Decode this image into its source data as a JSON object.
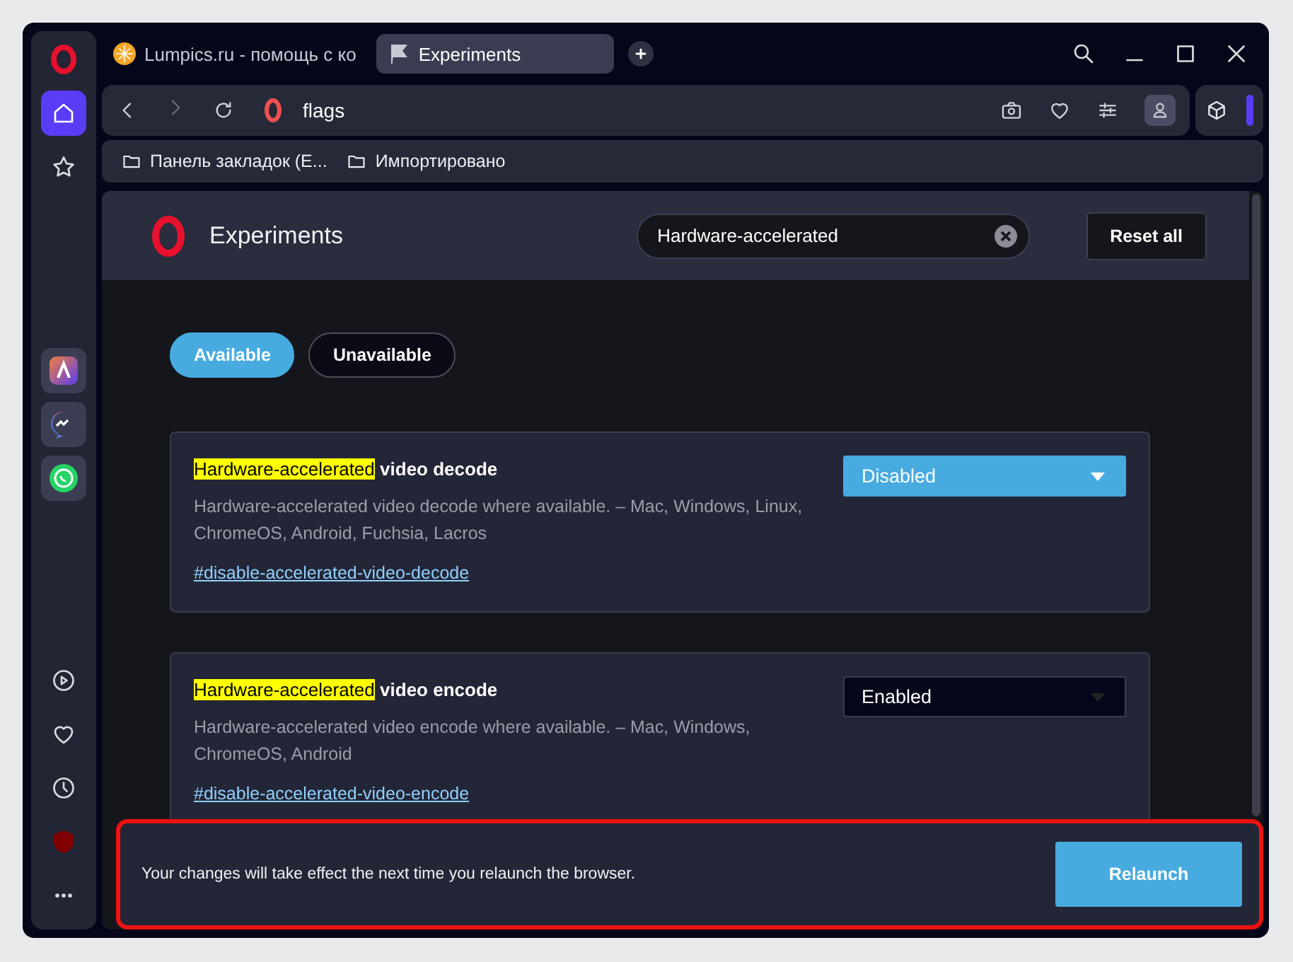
{
  "browser_tabs": [
    {
      "title": "Lumpics.ru - помощь с ко",
      "selected": false
    },
    {
      "title": "Experiments",
      "selected": true
    }
  ],
  "address_bar": {
    "value": "flags"
  },
  "bookmarks": [
    {
      "label": "Панель закладок (Е..."
    },
    {
      "label": "Импортировано"
    }
  ],
  "page": {
    "title": "Experiments",
    "search": {
      "value": "Hardware-accelerated"
    },
    "reset_button": "Reset all",
    "filter_tabs": [
      {
        "label": "Available",
        "selected": true
      },
      {
        "label": "Unavailable",
        "selected": false
      }
    ],
    "flags": [
      {
        "title_match": "Hardware-accelerated",
        "title_rest": "video decode",
        "description": "Hardware-accelerated video decode where available. – Mac, Windows, Linux, ChromeOS, Android, Fuchsia, Lacros",
        "link": "#disable-accelerated-video-decode",
        "value": "Disabled",
        "changed": true
      },
      {
        "title_match": "Hardware-accelerated",
        "title_rest": "video encode",
        "description": "Hardware-accelerated video encode where available. – Mac, Windows, ChromeOS, Android",
        "link": "#disable-accelerated-video-encode",
        "value": "Enabled",
        "changed": false
      }
    ],
    "notice": {
      "text": "Your changes will take effect the next time you relaunch the browser.",
      "button": "Relaunch"
    }
  }
}
